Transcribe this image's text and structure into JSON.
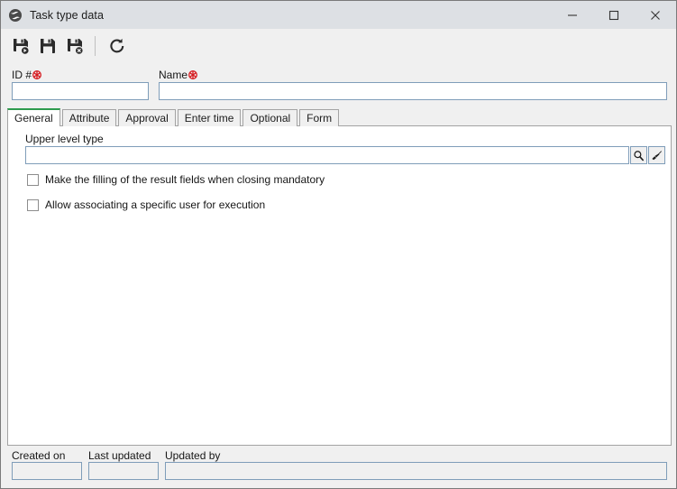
{
  "window": {
    "title": "Task type data",
    "icon": "globe-icon",
    "controls": {
      "minimize": "minimize-icon",
      "maximize": "maximize-icon",
      "close": "close-icon"
    },
    "colors": {
      "titlebar_bg": "#dde0e4",
      "toolbar_bg": "#f0f0f0",
      "panel_bg": "#ffffff",
      "field_border": "#7f9db9",
      "active_tab_accent": "#2e9b4e",
      "required_marker": "#d61b20"
    }
  },
  "toolbar": {
    "buttons": [
      {
        "name": "save-and-new-button",
        "icon": "save-new-icon",
        "label": "Save and new"
      },
      {
        "name": "save-button",
        "icon": "save-icon",
        "label": "Save"
      },
      {
        "name": "save-and-close-button",
        "icon": "save-close-icon",
        "label": "Save and close"
      },
      {
        "name": "refresh-button",
        "icon": "refresh-icon",
        "label": "Refresh"
      }
    ]
  },
  "header_fields": [
    {
      "label": "ID #",
      "required": true,
      "value": "",
      "placeholder": ""
    },
    {
      "label": "Name",
      "required": true,
      "value": "",
      "placeholder": ""
    }
  ],
  "tabs": [
    {
      "label": "General",
      "active": true
    },
    {
      "label": "Attribute",
      "active": false
    },
    {
      "label": "Approval",
      "active": false
    },
    {
      "label": "Enter time",
      "active": false
    },
    {
      "label": "Optional",
      "active": false
    },
    {
      "label": "Form",
      "active": false
    }
  ],
  "general_tab": {
    "upper_level": {
      "label": "Upper level type",
      "value": "",
      "placeholder": "",
      "lookup_icon": "magnifier-icon",
      "clear_icon": "brush-icon"
    },
    "checkboxes": [
      {
        "label": "Make the filling of the result fields when closing mandatory",
        "checked": false
      },
      {
        "label": "Allow associating a specific user for execution",
        "checked": false
      }
    ]
  },
  "footer_fields": [
    {
      "label": "Created on",
      "value": "",
      "readonly": true
    },
    {
      "label": "Last updated",
      "value": "",
      "readonly": true
    },
    {
      "label": "Updated by",
      "value": "",
      "readonly": true
    }
  ]
}
